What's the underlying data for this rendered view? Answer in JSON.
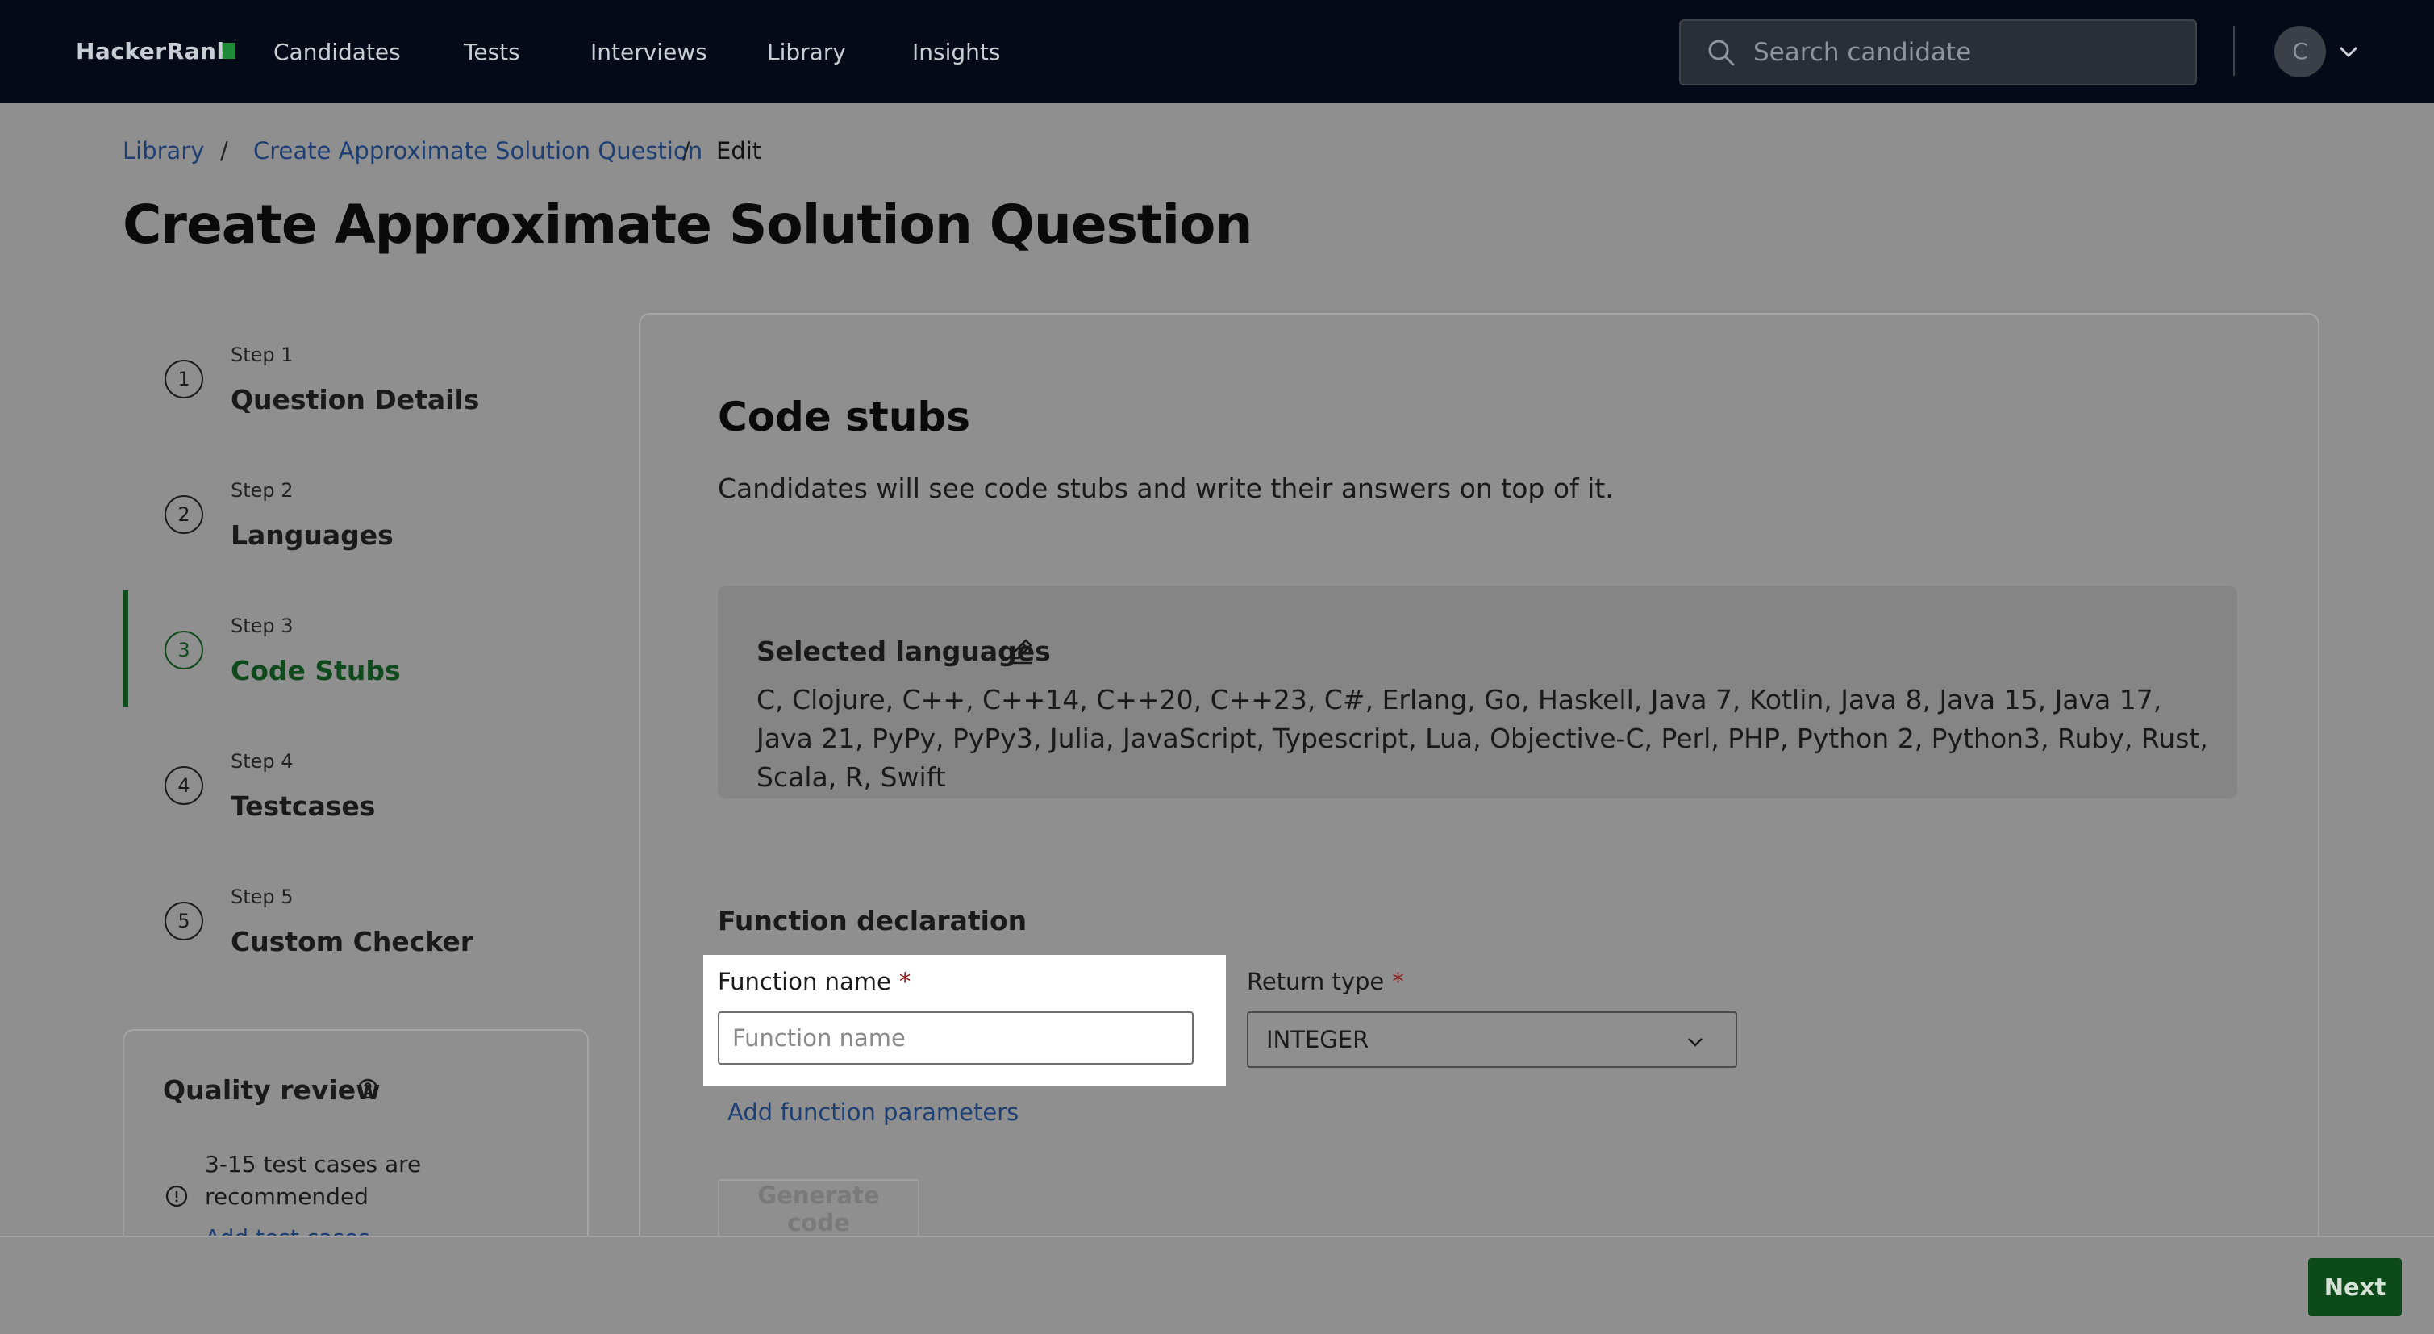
{
  "topbar": {
    "brand": "HackerRank",
    "nav": [
      "Candidates",
      "Tests",
      "Interviews",
      "Library",
      "Insights"
    ],
    "search_placeholder": "Search candidate",
    "avatar_initial": "C"
  },
  "breadcrumb": {
    "items": [
      "Library",
      "Create Approximate Solution Question",
      "Edit"
    ],
    "separator": "/"
  },
  "page_title": "Create Approximate Solution Question",
  "steps": [
    {
      "num": "1",
      "label": "Step 1",
      "title": "Question Details"
    },
    {
      "num": "2",
      "label": "Step 2",
      "title": "Languages"
    },
    {
      "num": "3",
      "label": "Step 3",
      "title": "Code Stubs",
      "active": true
    },
    {
      "num": "4",
      "label": "Step 4",
      "title": "Testcases"
    },
    {
      "num": "5",
      "label": "Step 5",
      "title": "Custom Checker"
    }
  ],
  "quality_review": {
    "title": "Quality review",
    "items": [
      {
        "text": "3-15 test cases are recommended",
        "link": "Add test cases"
      }
    ]
  },
  "code_stubs": {
    "title": "Code stubs",
    "description": "Candidates will see code stubs and write their answers on top of it.",
    "selected_languages_title": "Selected languages",
    "languages": "C, Clojure, C++, C++14, C++20, C++23, C#, Erlang, Go, Haskell, Java 7, Kotlin, Java 8, Java 15, Java 17, Java 21, PyPy, PyPy3, Julia, JavaScript, Typescript, Lua, Objective-C, Perl, PHP, Python 2, Python3, Ruby, Rust, Scala, R, Swift",
    "function_declaration_title": "Function declaration",
    "function_name_label": "Function name",
    "function_name_placeholder": "Function name",
    "function_name_value": "",
    "return_type_label": "Return type",
    "return_type_value": "INTEGER",
    "required_marker": "*",
    "add_params_label": "Add function parameters",
    "generate_label": "Generate code"
  },
  "footer": {
    "next_label": "Next"
  },
  "colors": {
    "topbar_bg": "#040a17",
    "overlay_bg": "#8f8f8f",
    "active_step": "#0f4a1c",
    "link": "#1d3f73",
    "required": "#8b1a1a",
    "primary_button": "#0d4a1a"
  }
}
